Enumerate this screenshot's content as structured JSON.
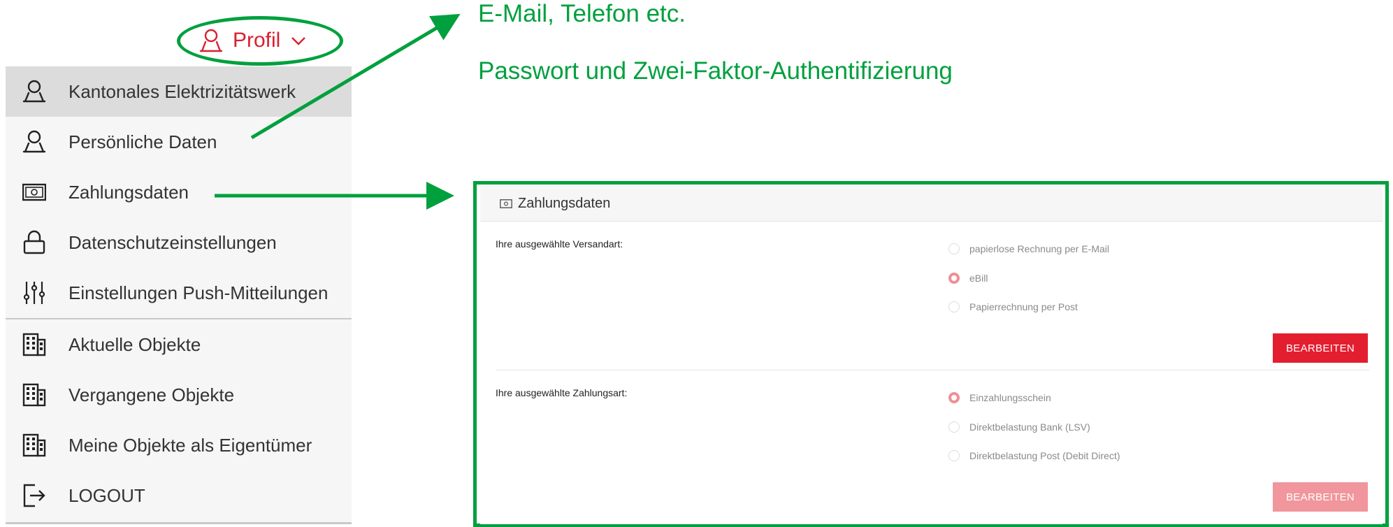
{
  "profile_menu": {
    "trigger_label": "Profil",
    "items": [
      {
        "label": "Kantonales Elektrizitätswerk",
        "icon": "user-icon"
      },
      {
        "label": "Persönliche Daten",
        "icon": "user-icon"
      },
      {
        "label": "Zahlungsdaten",
        "icon": "banknote-icon"
      },
      {
        "label": "Datenschutzeinstellungen",
        "icon": "lock-icon"
      },
      {
        "label": "Einstellungen Push-Mitteilungen",
        "icon": "sliders-icon"
      },
      {
        "label": "Aktuelle Objekte",
        "icon": "building-icon"
      },
      {
        "label": "Vergangene Objekte",
        "icon": "building-icon"
      },
      {
        "label": "Meine Objekte als Eigentümer",
        "icon": "building-icon"
      },
      {
        "label": "LOGOUT",
        "icon": "logout-icon"
      }
    ]
  },
  "annotations": {
    "line1": "E-Mail, Telefon etc.",
    "line2": "Passwort und Zwei-Faktor-Authentifizierung",
    "color": "#00a03e"
  },
  "payment_panel": {
    "title": "Zahlungsdaten",
    "delivery": {
      "label": "Ihre ausgewählte Versandart:",
      "options": [
        {
          "label": "papierlose Rechnung per E-Mail",
          "selected": false
        },
        {
          "label": "eBill",
          "selected": true
        },
        {
          "label": "Papierrechnung per Post",
          "selected": false
        }
      ],
      "button_label": "BEARBEITEN"
    },
    "payment": {
      "label": "Ihre ausgewählte Zahlungsart:",
      "options": [
        {
          "label": "Einzahlungsschein",
          "selected": true
        },
        {
          "label": "Direktbelastung Bank (LSV)",
          "selected": false
        },
        {
          "label": "Direktbelastung Post (Debit Direct)",
          "selected": false
        }
      ],
      "button_label": "BEARBEITEN"
    }
  },
  "colors": {
    "brand_red": "#e31e2f",
    "annotation_green": "#00a03e"
  }
}
